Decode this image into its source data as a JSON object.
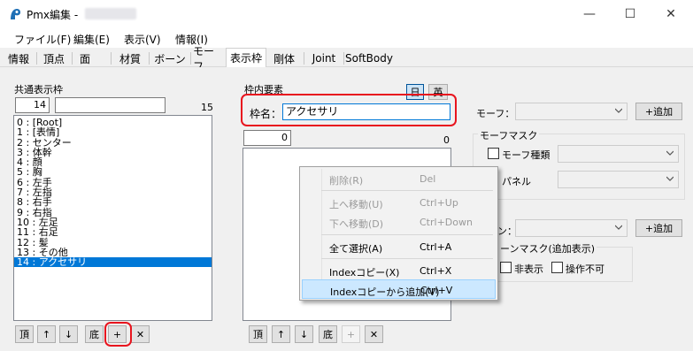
{
  "window": {
    "title": "Pmx編集 -",
    "minimize_glyph": "—",
    "maximize_glyph": "☐",
    "close_glyph": "✕"
  },
  "menu": [
    "ファイル(F)",
    "編集(E)",
    "表示(V)",
    "情報(I)"
  ],
  "tabs": [
    "情報",
    "頂点",
    "面",
    "材質",
    "ボーン",
    "モーフ",
    "表示枠",
    "剛体",
    "Joint",
    "SoftBody"
  ],
  "active_tab": "表示枠",
  "common_frames": {
    "label": "共通表示枠",
    "index_value": "14",
    "name_value": "",
    "count": "15",
    "items": [
      "0 : [Root]",
      "1 : [表情]",
      "2 : センター",
      "3 : 体幹",
      "4 : 顔",
      "5 : 胸",
      "6 : 左手",
      "7 : 左指",
      "8 : 右手",
      "9 : 右指",
      "10 : 左足",
      "11 : 右足",
      "12 : 髪",
      "13 : その他",
      "14 : アクセサリ"
    ],
    "selected_index": 14,
    "buttons": [
      "頂",
      "↑",
      "↓",
      "底",
      "+",
      "✕"
    ]
  },
  "frame_elements": {
    "label": "枠内要素",
    "toggle_day": "日",
    "toggle_en": "英",
    "frame_name_label": "枠名：",
    "frame_name_value": "アクセサリ",
    "index_value": "0",
    "count": "0",
    "buttons": [
      "頂",
      "↑",
      "↓",
      "底",
      "+",
      "✕"
    ]
  },
  "right_panel": {
    "morph_label": "モーフ：",
    "add_button": "+追加",
    "morph_mask_label": "モーフマスク",
    "morph_type_label": "モーフ種類",
    "panel_label": "パネル",
    "bone_label_partial": "ン：",
    "bone_mask_label": "ーンマスク(追加表示)",
    "hidden_label": "非表示",
    "locked_label": "操作不可"
  },
  "context_menu": {
    "items": [
      {
        "label": "削除(R)",
        "shortcut": "Del",
        "disabled": true
      },
      {
        "label": "上へ移動(U)",
        "shortcut": "Ctrl+Up",
        "disabled": true
      },
      {
        "label": "下へ移動(D)",
        "shortcut": "Ctrl+Down",
        "disabled": true
      },
      {
        "label": "全て選択(A)",
        "shortcut": "Ctrl+A",
        "disabled": false
      },
      {
        "label": "Indexコピー(X)",
        "shortcut": "Ctrl+X",
        "disabled": false
      },
      {
        "label": "Indexコピーから追加(V)",
        "shortcut": "Ctrl+V",
        "disabled": false,
        "highlighted": true
      }
    ]
  },
  "colors": {
    "selection": "#0078d7",
    "highlight_red": "#e8141e",
    "menu_highlight": "#cce8ff",
    "app_icon": "#1e6fb5"
  }
}
